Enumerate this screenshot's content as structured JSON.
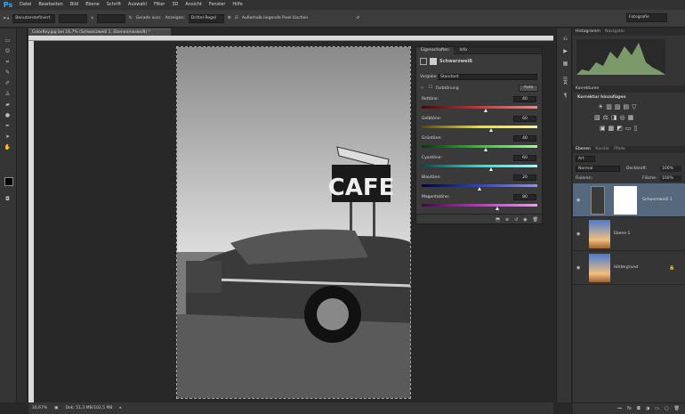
{
  "app": {
    "logo": "Ps"
  },
  "menu": [
    "Datei",
    "Bearbeiten",
    "Bild",
    "Ebene",
    "Schrift",
    "Auswahl",
    "Filter",
    "3D",
    "Ansicht",
    "Fenster",
    "Hilfe"
  ],
  "options": {
    "style": "Benutzerdefiniert",
    "swap": "x",
    "straighten": "Gerade ausr.",
    "view_label": "Anzeigen:",
    "view_value": "Drittel-Regel",
    "delete_pixels": "Außerhalb liegende Pixel löschen",
    "workspace": "Fotografie"
  },
  "document": {
    "tab": "ColorKey.jpg bei 16,7% (Schwarzweiß 1, Ebenenmaske/8) *",
    "zoom": "16,67%",
    "doc_size": "Dok: 51,3 MB/102,5 MB"
  },
  "properties": {
    "tab1": "Eigenschaften",
    "tab2": "Info",
    "title": "Schwarzweiß",
    "preset_label": "Vorgabe:",
    "preset_value": "Standard",
    "tint_label": "Farbtönung",
    "auto_label": "Auto",
    "sliders": [
      {
        "label": "Rottöne:",
        "value": "40",
        "pct": 0.55
      },
      {
        "label": "Gelbtöne:",
        "value": "60",
        "pct": 0.6
      },
      {
        "label": "Grüntöne:",
        "value": "40",
        "pct": 0.55
      },
      {
        "label": "Cyantöne:",
        "value": "60",
        "pct": 0.6
      },
      {
        "label": "Blautöne:",
        "value": "20",
        "pct": 0.5
      },
      {
        "label": "Magentatöne:",
        "value": "80",
        "pct": 0.65
      }
    ],
    "slider_gradients": [
      "linear-gradient(90deg,#5a0000,#ff2020,#ff8080)",
      "linear-gradient(90deg,#5a4a00,#f0e020,#fff080)",
      "linear-gradient(90deg,#003a00,#20d020,#90ff90)",
      "linear-gradient(90deg,#004a4a,#20e0e0,#90ffff)",
      "linear-gradient(90deg,#00004a,#2040ff,#9090ff)",
      "linear-gradient(90deg,#4a004a,#e020e0,#ff90ff)"
    ]
  },
  "right_panels": {
    "histogram_tabs": [
      "Histogramm",
      "Navigator"
    ],
    "adjust_tabs": [
      "Korrekturen"
    ],
    "adjust_title": "Korrektur hinzufügen",
    "layers_tabs": [
      "Ebenen",
      "Kanäle",
      "Pfade"
    ],
    "filter_kind": "Art",
    "blend": "Normal",
    "opacity_label": "Deckkraft:",
    "opacity": "100%",
    "lock_label": "Fixieren:",
    "fill_label": "Fläche:",
    "fill": "100%",
    "layers": [
      {
        "name": "Schwarzweiß 1"
      },
      {
        "name": "Ebene 1"
      },
      {
        "name": "Hintergrund"
      }
    ]
  },
  "sign_text": "CAFE"
}
